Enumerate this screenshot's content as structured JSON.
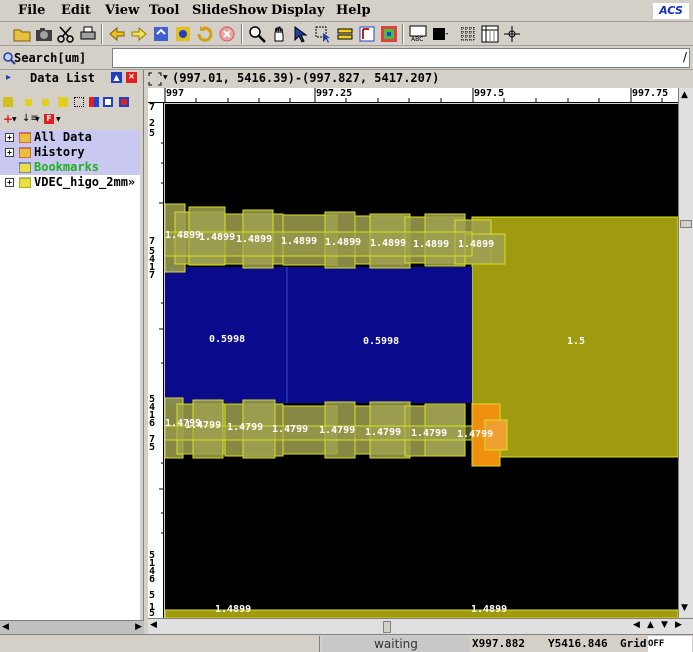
{
  "menu": {
    "file": "File",
    "edit": "Edit",
    "view": "View",
    "tool": "Tool",
    "slideshow": "SlideShow",
    "display": "Display",
    "help": "Help"
  },
  "logo_text": "ACS",
  "search": {
    "label": "Search[um]",
    "value": ""
  },
  "data_list": {
    "title": "Data List",
    "items": [
      {
        "label": "All Data"
      },
      {
        "label": "History"
      },
      {
        "label": "Bookmarks"
      },
      {
        "label": "VDEC_higo_2mm»"
      }
    ]
  },
  "coords_text": "(997.01, 5416.39)-(997.827, 5417.207)",
  "hruler": {
    "labels": [
      "997",
      "997.25",
      "997.5",
      "997.75"
    ]
  },
  "vruler": {
    "labels": [
      "7",
      "2",
      "5",
      "7",
      "5",
      "4",
      "1",
      "7",
      "5",
      "4",
      "1",
      "6",
      "7",
      "5",
      "5",
      "1",
      "4",
      "6",
      "5",
      "1",
      "5"
    ]
  },
  "layout": {
    "top_band_values": [
      "1.4899",
      "1.4899",
      "1.4899",
      "1.4899",
      "1.4899",
      "1.4899",
      "1.4899",
      "1.4899"
    ],
    "bottom_band_values": [
      "1.4799",
      "1.4799",
      "1.4799",
      "1.4799",
      "1.4799",
      "1.4799",
      "1.4799",
      "1.4799"
    ],
    "center_left_value": "0.5998",
    "center_mid_value": "0.5998",
    "right_block_value": "1.5",
    "bottom_edge_values": [
      "1.4899",
      "1.4899"
    ],
    "colors": {
      "background": "#000000",
      "blue_region": "#0a0a8c",
      "olive_region": "#a09a10",
      "band_fill": "#9ea050",
      "band_outline": "#d8e020",
      "orange": "#f09010"
    }
  },
  "status": {
    "message": "waiting",
    "x_label": "X",
    "x_value": "997.882",
    "y_label": "Y",
    "y_value": "5416.846",
    "grid_label": "Grid",
    "grid_value": "OFF"
  }
}
